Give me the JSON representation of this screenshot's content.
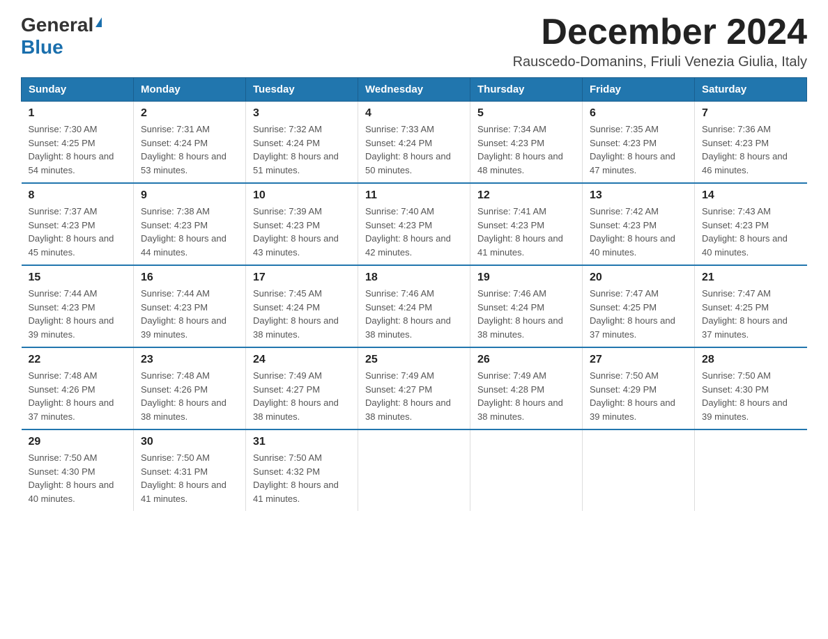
{
  "logo": {
    "general": "General",
    "blue": "Blue"
  },
  "title": "December 2024",
  "subtitle": "Rauscedo-Domanins, Friuli Venezia Giulia, Italy",
  "headers": [
    "Sunday",
    "Monday",
    "Tuesday",
    "Wednesday",
    "Thursday",
    "Friday",
    "Saturday"
  ],
  "weeks": [
    [
      {
        "day": "1",
        "sunrise": "7:30 AM",
        "sunset": "4:25 PM",
        "daylight": "8 hours and 54 minutes."
      },
      {
        "day": "2",
        "sunrise": "7:31 AM",
        "sunset": "4:24 PM",
        "daylight": "8 hours and 53 minutes."
      },
      {
        "day": "3",
        "sunrise": "7:32 AM",
        "sunset": "4:24 PM",
        "daylight": "8 hours and 51 minutes."
      },
      {
        "day": "4",
        "sunrise": "7:33 AM",
        "sunset": "4:24 PM",
        "daylight": "8 hours and 50 minutes."
      },
      {
        "day": "5",
        "sunrise": "7:34 AM",
        "sunset": "4:23 PM",
        "daylight": "8 hours and 48 minutes."
      },
      {
        "day": "6",
        "sunrise": "7:35 AM",
        "sunset": "4:23 PM",
        "daylight": "8 hours and 47 minutes."
      },
      {
        "day": "7",
        "sunrise": "7:36 AM",
        "sunset": "4:23 PM",
        "daylight": "8 hours and 46 minutes."
      }
    ],
    [
      {
        "day": "8",
        "sunrise": "7:37 AM",
        "sunset": "4:23 PM",
        "daylight": "8 hours and 45 minutes."
      },
      {
        "day": "9",
        "sunrise": "7:38 AM",
        "sunset": "4:23 PM",
        "daylight": "8 hours and 44 minutes."
      },
      {
        "day": "10",
        "sunrise": "7:39 AM",
        "sunset": "4:23 PM",
        "daylight": "8 hours and 43 minutes."
      },
      {
        "day": "11",
        "sunrise": "7:40 AM",
        "sunset": "4:23 PM",
        "daylight": "8 hours and 42 minutes."
      },
      {
        "day": "12",
        "sunrise": "7:41 AM",
        "sunset": "4:23 PM",
        "daylight": "8 hours and 41 minutes."
      },
      {
        "day": "13",
        "sunrise": "7:42 AM",
        "sunset": "4:23 PM",
        "daylight": "8 hours and 40 minutes."
      },
      {
        "day": "14",
        "sunrise": "7:43 AM",
        "sunset": "4:23 PM",
        "daylight": "8 hours and 40 minutes."
      }
    ],
    [
      {
        "day": "15",
        "sunrise": "7:44 AM",
        "sunset": "4:23 PM",
        "daylight": "8 hours and 39 minutes."
      },
      {
        "day": "16",
        "sunrise": "7:44 AM",
        "sunset": "4:23 PM",
        "daylight": "8 hours and 39 minutes."
      },
      {
        "day": "17",
        "sunrise": "7:45 AM",
        "sunset": "4:24 PM",
        "daylight": "8 hours and 38 minutes."
      },
      {
        "day": "18",
        "sunrise": "7:46 AM",
        "sunset": "4:24 PM",
        "daylight": "8 hours and 38 minutes."
      },
      {
        "day": "19",
        "sunrise": "7:46 AM",
        "sunset": "4:24 PM",
        "daylight": "8 hours and 38 minutes."
      },
      {
        "day": "20",
        "sunrise": "7:47 AM",
        "sunset": "4:25 PM",
        "daylight": "8 hours and 37 minutes."
      },
      {
        "day": "21",
        "sunrise": "7:47 AM",
        "sunset": "4:25 PM",
        "daylight": "8 hours and 37 minutes."
      }
    ],
    [
      {
        "day": "22",
        "sunrise": "7:48 AM",
        "sunset": "4:26 PM",
        "daylight": "8 hours and 37 minutes."
      },
      {
        "day": "23",
        "sunrise": "7:48 AM",
        "sunset": "4:26 PM",
        "daylight": "8 hours and 38 minutes."
      },
      {
        "day": "24",
        "sunrise": "7:49 AM",
        "sunset": "4:27 PM",
        "daylight": "8 hours and 38 minutes."
      },
      {
        "day": "25",
        "sunrise": "7:49 AM",
        "sunset": "4:27 PM",
        "daylight": "8 hours and 38 minutes."
      },
      {
        "day": "26",
        "sunrise": "7:49 AM",
        "sunset": "4:28 PM",
        "daylight": "8 hours and 38 minutes."
      },
      {
        "day": "27",
        "sunrise": "7:50 AM",
        "sunset": "4:29 PM",
        "daylight": "8 hours and 39 minutes."
      },
      {
        "day": "28",
        "sunrise": "7:50 AM",
        "sunset": "4:30 PM",
        "daylight": "8 hours and 39 minutes."
      }
    ],
    [
      {
        "day": "29",
        "sunrise": "7:50 AM",
        "sunset": "4:30 PM",
        "daylight": "8 hours and 40 minutes."
      },
      {
        "day": "30",
        "sunrise": "7:50 AM",
        "sunset": "4:31 PM",
        "daylight": "8 hours and 41 minutes."
      },
      {
        "day": "31",
        "sunrise": "7:50 AM",
        "sunset": "4:32 PM",
        "daylight": "8 hours and 41 minutes."
      },
      null,
      null,
      null,
      null
    ]
  ],
  "labels": {
    "sunrise": "Sunrise:",
    "sunset": "Sunset:",
    "daylight": "Daylight:"
  }
}
